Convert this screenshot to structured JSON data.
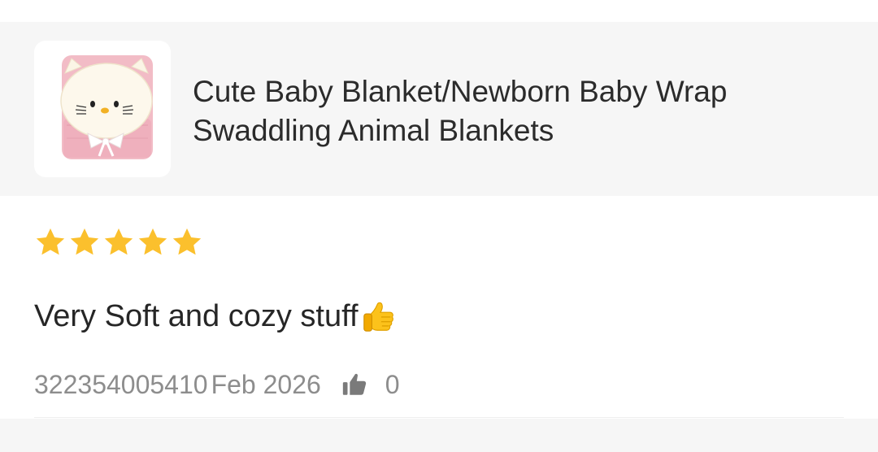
{
  "product": {
    "title": "Cute Baby Blanket/Newborn Baby Wrap Swaddling Animal Blankets",
    "image_icon": "pink-kitty-hooded-blanket-image"
  },
  "review": {
    "rating": 5,
    "rating_max": 5,
    "star_color": "#fbc02d",
    "text": "Very Soft and cozy stuff",
    "text_emoji": "thumbs-up-emoji",
    "reviewer_id": "322354005410",
    "date": "Feb 2026",
    "like_icon": "thumbs-up-icon",
    "like_count": "0"
  },
  "colors": {
    "card_background": "#f6f6f6",
    "meta_text": "#8d8d8d",
    "product_pink": "#f2bcc6"
  }
}
